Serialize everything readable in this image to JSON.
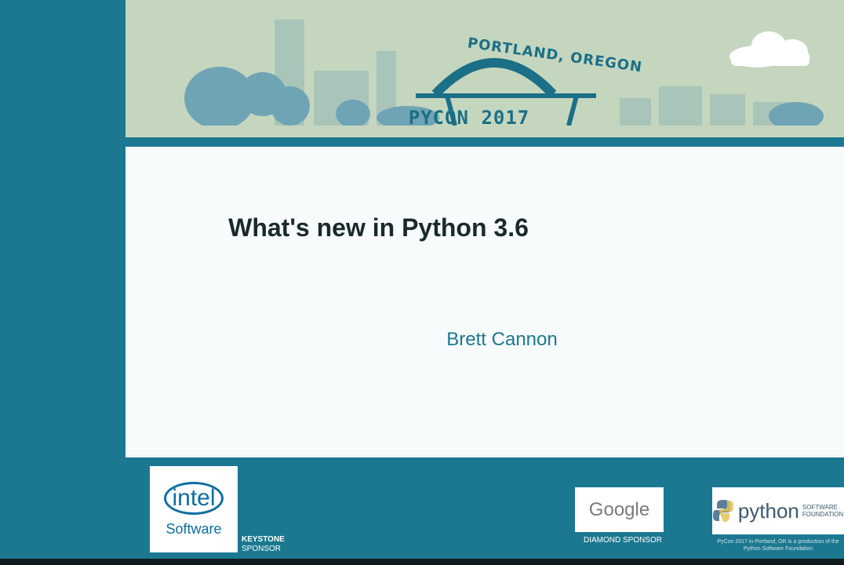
{
  "banner": {
    "location": "PORTLAND, OREGON",
    "event": "PYCON 2017"
  },
  "slide": {
    "title": "What's new in Python 3.6",
    "author": "Brett Cannon"
  },
  "sponsors": {
    "intel_logo": "intel",
    "intel_software": "Software",
    "keystone_label_1": "KEYSTONE",
    "keystone_label_2": "SPONSOR",
    "google_logo": "Google",
    "diamond_label": "DIAMOND SPONSOR",
    "psf_word": "python",
    "psf_sub_1": "SOFTWARE",
    "psf_sub_2": "FOUNDATION",
    "psf_note_1": "PyCon 2017 in Portland, OR is a production of the",
    "psf_note_2": "Python Software Foundation"
  },
  "colors": {
    "teal": "#1b7890",
    "banner_bg": "#c5d6bf",
    "slide_bg": "#f7fbfb"
  }
}
